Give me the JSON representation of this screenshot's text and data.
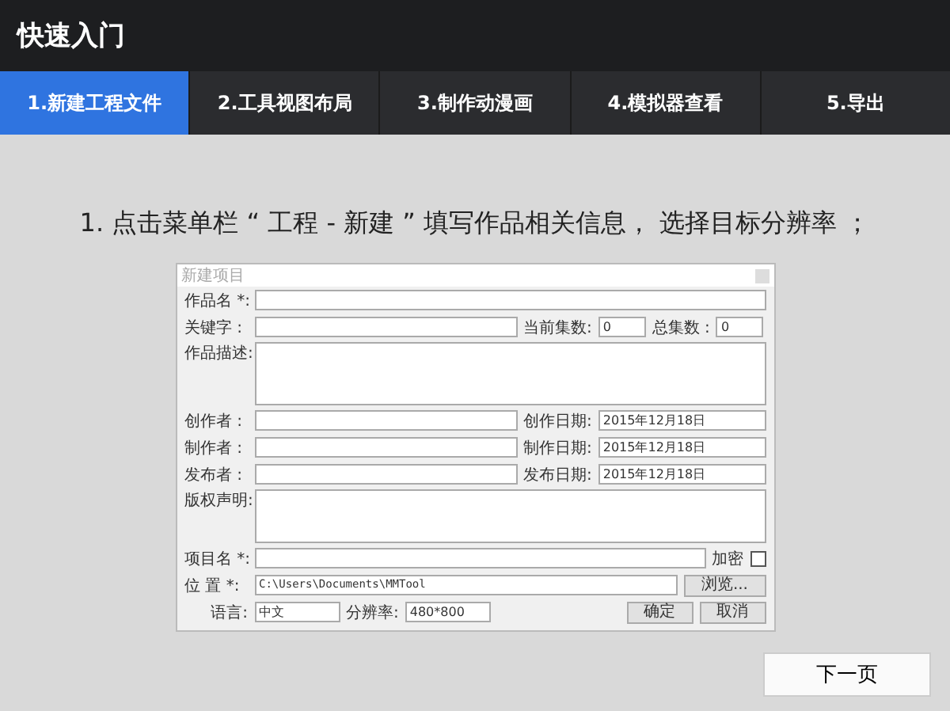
{
  "window": {
    "title": "快速入门"
  },
  "tabs": [
    {
      "label": "1.新建工程文件",
      "selected": true
    },
    {
      "label": "2.工具视图布局",
      "selected": false
    },
    {
      "label": "3.制作动漫画",
      "selected": false
    },
    {
      "label": "4.模拟器查看",
      "selected": false
    },
    {
      "label": "5.导出",
      "selected": false
    }
  ],
  "instruction": "1. 点击菜单栏 “ 工程 - 新建 ” 填写作品相关信息， 选择目标分辨率 ；",
  "dialog": {
    "title": "新建项目",
    "name_label": "作品名 *:",
    "keyword_label": "关键字 :",
    "current_episode_label": "当前集数:",
    "current_episode": "0",
    "total_episode_label": "总集数 :",
    "total_episode": "0",
    "description_label": "作品描述:",
    "people": [
      {
        "label": "创作者 :",
        "date_label": "创作日期:",
        "date": "2015年12月18日"
      },
      {
        "label": "制作者 :",
        "date_label": "制作日期:",
        "date": "2015年12月18日"
      },
      {
        "label": "发布者 :",
        "date_label": "发布日期:",
        "date": "2015年12月18日"
      }
    ],
    "copyright_label": "版权声明:",
    "project_label": "项目名 *:",
    "encrypt_label": "加密",
    "encrypt_checked": false,
    "location_label": "位  置 *:",
    "location": "C:\\Users\\Documents\\MMTool",
    "browse": "浏览...",
    "language_label": "语言:",
    "language": "中文",
    "resolution_label": "分辨率:",
    "resolution": "480*800",
    "ok": "确定",
    "cancel": "取消"
  },
  "next_button": "下一页"
}
